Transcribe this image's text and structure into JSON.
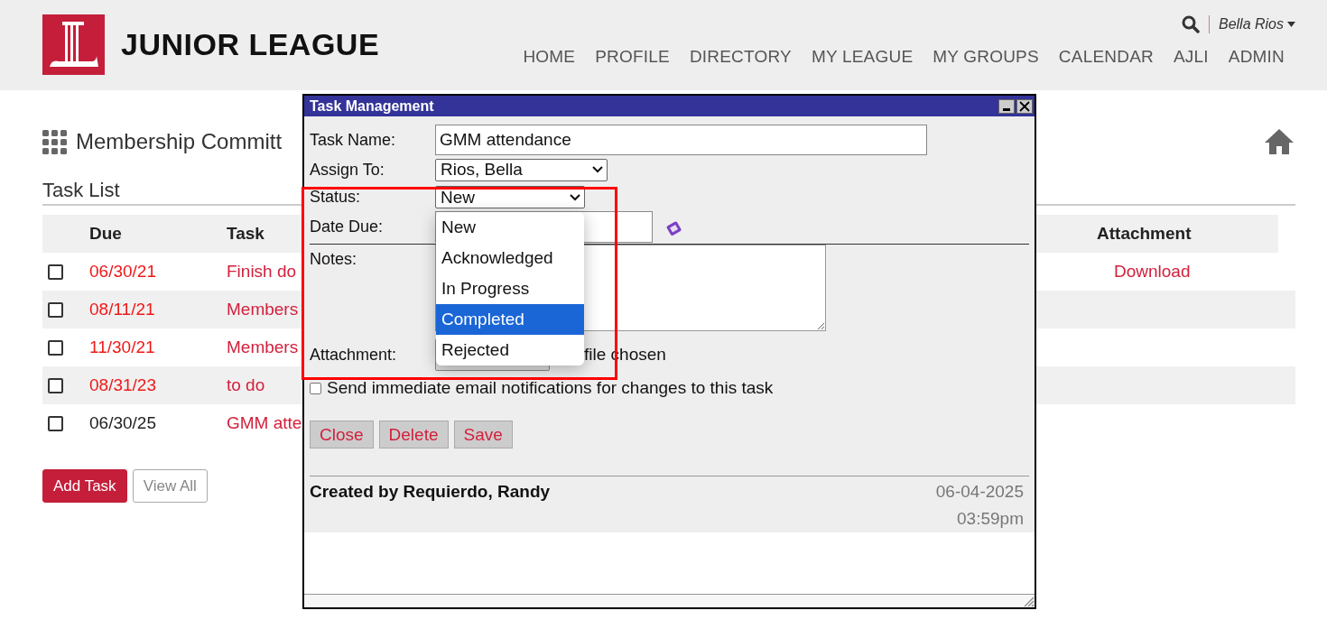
{
  "header": {
    "logo_text": "JUNIOR LEAGUE",
    "user": "Bella Rios",
    "nav": [
      "HOME",
      "PROFILE",
      "DIRECTORY",
      "MY LEAGUE",
      "MY GROUPS",
      "CALENDAR",
      "AJLI",
      "ADMIN"
    ]
  },
  "page": {
    "title": "Membership Committ",
    "section": "Task List",
    "columns": [
      "Due",
      "Task",
      "Attachment"
    ],
    "rows": [
      {
        "checked": false,
        "due": "06/30/21",
        "overdue": true,
        "task": "Finish do",
        "attachment": "Download"
      },
      {
        "checked": false,
        "due": "08/11/21",
        "overdue": true,
        "task": "Members"
      },
      {
        "checked": false,
        "due": "11/30/21",
        "overdue": true,
        "task": "Members"
      },
      {
        "checked": false,
        "due": "08/31/23",
        "overdue": true,
        "task": "to do"
      },
      {
        "checked": false,
        "due": "06/30/25",
        "overdue": false,
        "task": "GMM atte"
      }
    ],
    "buttons": [
      {
        "kind": "primary",
        "label": "Add Task"
      },
      {
        "kind": "outline",
        "label": "View All"
      }
    ]
  },
  "dialog": {
    "title": "Task Management",
    "task_name": {
      "label": "Task Name:",
      "value": "GMM attendance"
    },
    "assign_to": {
      "label": "Assign To:",
      "value": "Rios, Bella"
    },
    "status": {
      "label": "Status:",
      "value": "New",
      "expanded": true,
      "options": [
        {
          "label": "New",
          "highlighted": false
        },
        {
          "label": "Acknowledged",
          "highlighted": false
        },
        {
          "label": "In Progress",
          "highlighted": false
        },
        {
          "label": "Completed",
          "highlighted": true
        },
        {
          "label": "Rejected",
          "highlighted": false
        }
      ]
    },
    "date_due": {
      "label": "Date Due:"
    },
    "notes": {
      "label": "Notes:"
    },
    "attachment": {
      "label": "Attachment:",
      "file_status": "file chosen"
    },
    "notify": {
      "label": "Send immediate email notifications for changes to this task",
      "checked": false
    },
    "buttons": [
      "Close",
      "Delete",
      "Save"
    ],
    "created_by": "Created by Requierdo, Randy",
    "created_date": "06-04-2025",
    "created_time": "03:59pm"
  }
}
